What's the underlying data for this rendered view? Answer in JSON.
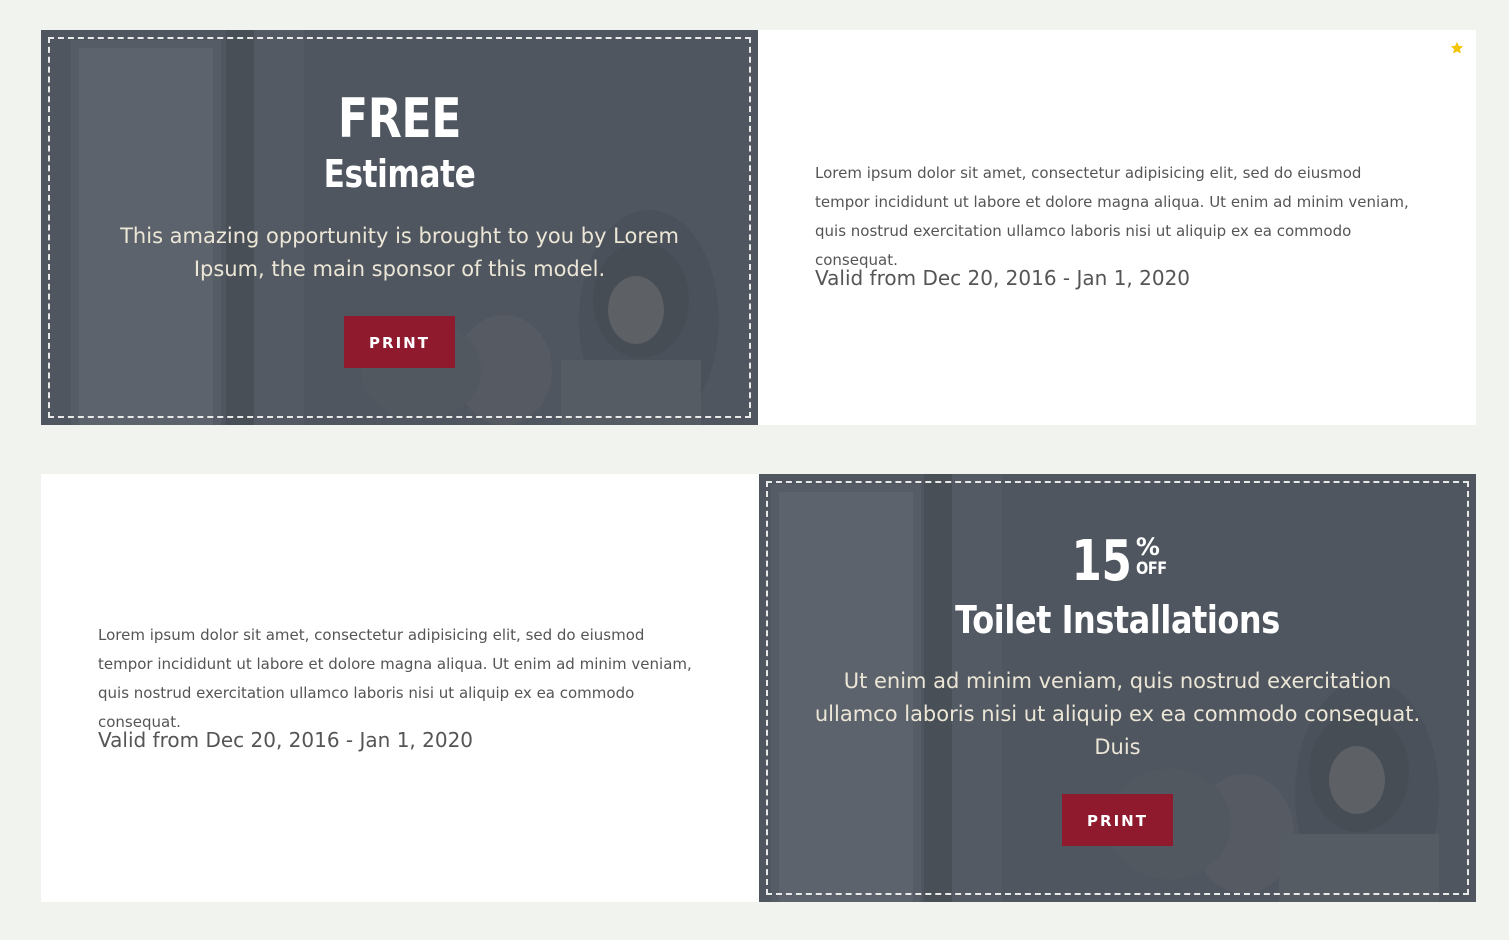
{
  "coupons": [
    {
      "title": "FREE",
      "subtitle": "Estimate",
      "description": "This amazing opportunity is brought to you by Lorem Ipsum, the main sponsor of this model.",
      "print_label": "PRINT",
      "details": "Lorem ipsum dolor sit amet, consectetur adipisicing elit, sed do eiusmod tempor incididunt ut labore et dolore magna aliqua. Ut enim ad minim veniam, quis nostrud exercitation ullamco laboris nisi ut aliquip ex ea commodo consequat.",
      "validity": "Valid from Dec 20, 2016 - Jan 1, 2020",
      "featured_icon": "star-icon"
    },
    {
      "percent_value": "15",
      "percent_sign": "%",
      "off_label": "OFF",
      "subtitle": "Toilet Installations",
      "description": "Ut enim ad minim veniam, quis nostrud exercitation ullamco laboris nisi ut aliquip ex ea commodo consequat. Duis",
      "print_label": "PRINT",
      "details": "Lorem ipsum dolor sit amet, consectetur adipisicing elit, sed do eiusmod tempor incididunt ut labore et dolore magna aliqua. Ut enim ad minim veniam, quis nostrud exercitation ullamco laboris nisi ut aliquip ex ea commodo consequat.",
      "validity": "Valid from Dec 20, 2016 - Jan 1, 2020"
    }
  ],
  "colors": {
    "page_background": "#f1f3ee",
    "promo_overlay": "#515862",
    "print_button": "#8f1a2e",
    "star": "#f5c400",
    "description_text": "#ece6d6"
  }
}
